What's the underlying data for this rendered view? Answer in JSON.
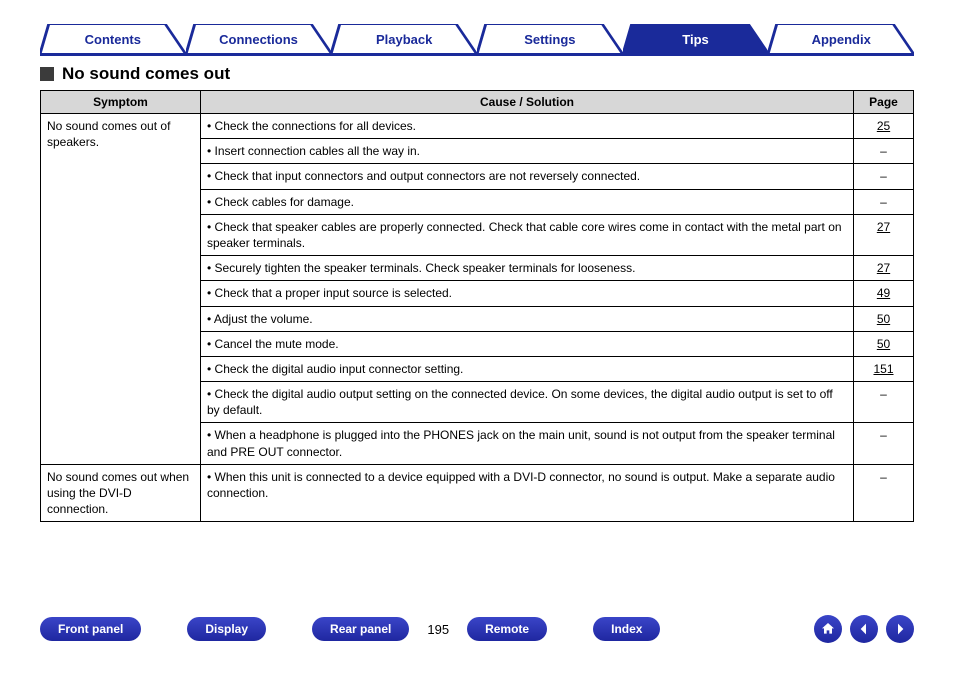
{
  "tabs": {
    "items": [
      {
        "label": "Contents",
        "active": false
      },
      {
        "label": "Connections",
        "active": false
      },
      {
        "label": "Playback",
        "active": false
      },
      {
        "label": "Settings",
        "active": false
      },
      {
        "label": "Tips",
        "active": true
      },
      {
        "label": "Appendix",
        "active": false
      }
    ]
  },
  "section": {
    "title": "No sound comes out"
  },
  "table": {
    "headers": {
      "symptom": "Symptom",
      "cause": "Cause / Solution",
      "page": "Page"
    },
    "groups": [
      {
        "symptom": "No sound comes out of speakers.",
        "rows": [
          {
            "cause": "Check the connections for all devices.",
            "page": "25"
          },
          {
            "cause": "Insert connection cables all the way in.",
            "page": "–"
          },
          {
            "cause": "Check that input connectors and output connectors are not reversely connected.",
            "page": "–"
          },
          {
            "cause": "Check cables for damage.",
            "page": "–"
          },
          {
            "cause": "Check that speaker cables are properly connected. Check that cable core wires come in contact with the metal part on speaker terminals.",
            "page": "27"
          },
          {
            "cause": "Securely tighten the speaker terminals. Check speaker terminals for looseness.",
            "page": "27"
          },
          {
            "cause": "Check that a proper input source is selected.",
            "page": "49"
          },
          {
            "cause": "Adjust the volume.",
            "page": "50"
          },
          {
            "cause": "Cancel the mute mode.",
            "page": "50"
          },
          {
            "cause": "Check the digital audio input connector setting.",
            "page": "151"
          },
          {
            "cause": "Check the digital audio output setting on the connected device. On some devices, the digital audio output is set to off by default.",
            "page": "–"
          },
          {
            "cause": "When a headphone is plugged into the PHONES jack on the main unit, sound is not output from the speaker terminal and PRE OUT connector.",
            "page": "–"
          }
        ]
      },
      {
        "symptom": "No sound comes out when using the DVI-D connection.",
        "rows": [
          {
            "cause": "When this unit is connected to a device equipped with a DVI-D connector, no sound is output. Make a separate audio connection.",
            "page": "–"
          }
        ]
      }
    ]
  },
  "footer": {
    "pills": {
      "front": "Front panel",
      "display": "Display",
      "rear": "Rear panel",
      "remote": "Remote",
      "index": "Index"
    },
    "page_number": "195"
  }
}
